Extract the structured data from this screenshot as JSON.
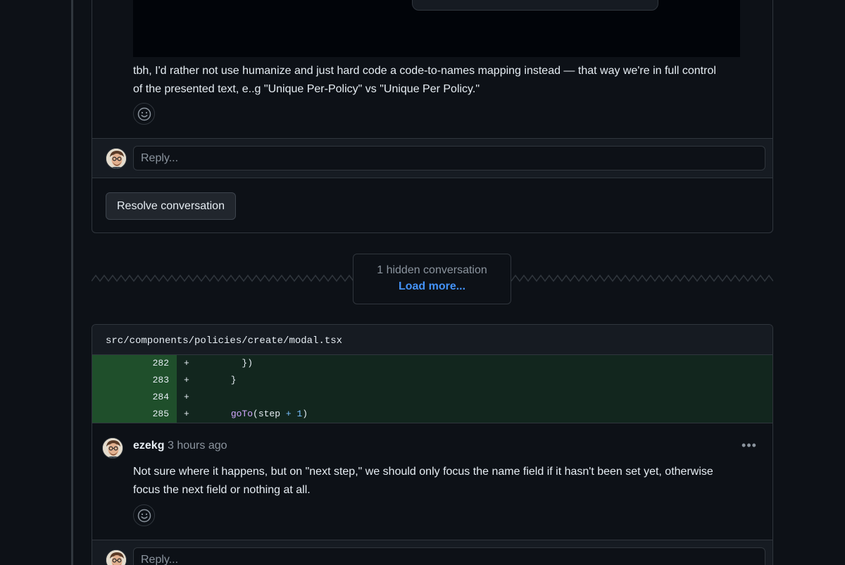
{
  "thread1": {
    "comment_line1": "tbh, I'd rather not use humanize and just hard code a code-to-names mapping instead — that way we're in full control",
    "comment_line2": "of the presented text, e..g \"Unique Per-Policy\" vs \"Unique Per Policy.\"",
    "reply_placeholder": "Reply...",
    "resolve_label": "Resolve conversation"
  },
  "hidden": {
    "count_label": "1 hidden conversation",
    "load_more_label": "Load more..."
  },
  "thread2": {
    "file_path": "src/components/policies/create/modal.tsx",
    "diff": [
      {
        "line": "282",
        "sign": "+",
        "code": "        })"
      },
      {
        "line": "283",
        "sign": "+",
        "code": "      }"
      },
      {
        "line": "284",
        "sign": "+",
        "code": ""
      },
      {
        "line": "285",
        "sign": "+",
        "code_fn": "goTo",
        "code_rest_open": "(step ",
        "code_op": "+",
        "code_num": " 1",
        "code_close": ")"
      }
    ],
    "author": "ezekg",
    "timestamp": "3 hours ago",
    "more_label": "•••",
    "comment_line1": "Not sure where it happens, but on \"next step,\" we should only focus the name field if it hasn't been set yet, otherwise",
    "comment_line2": "focus the next field or nothing at all.",
    "reply_placeholder": "Reply..."
  },
  "icons": {
    "reaction": "smiley-icon",
    "kebab": "kebab-horizontal-icon",
    "avatar": "user-avatar"
  },
  "colors": {
    "background": "#0d1117",
    "border": "#30363d",
    "link": "#4493f8",
    "diff_added_bg": "#12261e",
    "diff_added_num_bg": "#1f4f2b"
  }
}
